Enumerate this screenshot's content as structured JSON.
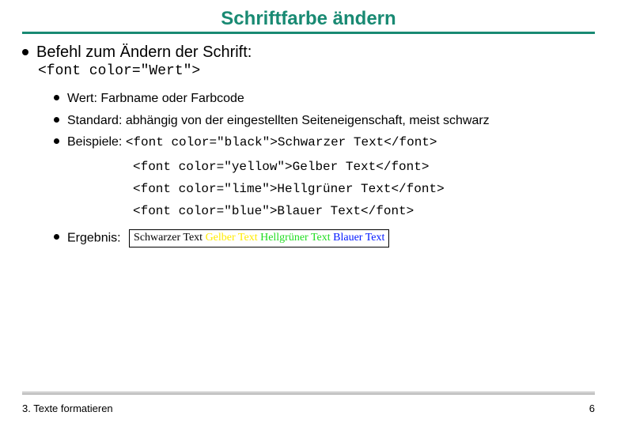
{
  "title": "Schriftfarbe ändern",
  "heading": "Befehl zum Ändern der Schrift:",
  "syntax": "<font color=\"Wert\">",
  "bullets": {
    "wert": "Wert: Farbname oder Farbcode",
    "standard": "Standard: abhängig von der eingestellten Seiteneigenschaft, meist schwarz",
    "beispiele_label": "Beispiele:",
    "ergebnis_label": "Ergebnis:"
  },
  "examples": {
    "e1": "<font color=\"black\">Schwarzer Text</font>",
    "e2": "<font color=\"yellow\">Gelber Text</font>",
    "e3": "<font color=\"lime\">Hellgrüner Text</font>",
    "e4": "<font color=\"blue\">Blauer Text</font>"
  },
  "result": {
    "black": "Schwarzer Text",
    "yellow": "Gelber Text",
    "lime": "Hellgrüner Text",
    "blue": "Blauer Text"
  },
  "footer": {
    "left": "3. Texte formatieren",
    "right": "6"
  }
}
